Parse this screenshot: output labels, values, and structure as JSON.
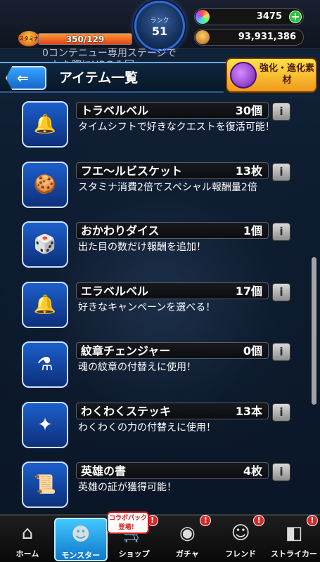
{
  "status": {
    "stamina_label": "スタミナ",
    "stamina_text": "350/129",
    "stamina_fraction": 1.0,
    "rank_label": "ランク",
    "rank_value": "51",
    "orbs": "3475",
    "orb_plus": "+",
    "gold": "93,931,386"
  },
  "header": {
    "background_text": "0コンテニュー専用ステージで\n…した際にHPのみ回",
    "back_icon": "back-arrow-icon",
    "title": "アイテム一覧",
    "evolve_label": "強化・進化素材"
  },
  "items": [
    {
      "name": "トラベルベル",
      "count": "30個",
      "desc": "タイムシフトで好きなクエストを復活可能！",
      "icon": "bell-icon",
      "glyph": "🔔"
    },
    {
      "name": "フエ〜ルビスケット",
      "count": "13枚",
      "desc": "スタミナ消費2倍でスペシャル報酬量2倍",
      "icon": "biscuit-icon",
      "glyph": "🍪"
    },
    {
      "name": "おかわりダイス",
      "count": "1個",
      "desc": "出た目の数だけ報酬を追加！",
      "icon": "dice-icon",
      "glyph": "🎲"
    },
    {
      "name": "エラベルベル",
      "count": "17個",
      "desc": "好きなキャンペーンを選べる！",
      "icon": "golden-bell-icon",
      "glyph": "🔔"
    },
    {
      "name": "紋章チェンジャー",
      "count": "0個",
      "desc": "魂の紋章の付替えに使用！",
      "icon": "emblem-changer-icon",
      "glyph": "⚗"
    },
    {
      "name": "わくわくステッキ",
      "count": "13本",
      "desc": "わくわくの力の付替えに使用！",
      "icon": "wand-icon",
      "glyph": "✦"
    },
    {
      "name": "英雄の書",
      "count": "4枚",
      "desc": "英雄の証が獲得可能！",
      "icon": "scroll-icon",
      "glyph": "📜"
    }
  ],
  "info_button_label": "i",
  "nav": {
    "collab_sticker": "コラボパック登場！",
    "tabs": [
      {
        "label": "ホーム",
        "icon": "home-icon",
        "glyph": "⌂"
      },
      {
        "label": "モンスター",
        "icon": "monster-icon",
        "glyph": "☻"
      },
      {
        "label": "ショップ",
        "icon": "shop-cart-icon",
        "glyph": "🛒"
      },
      {
        "label": "ガチャ",
        "icon": "gacha-icon",
        "glyph": "◉"
      },
      {
        "label": "フレンド",
        "icon": "friend-icon",
        "glyph": "☺"
      },
      {
        "label": "ストライカー",
        "icon": "striker-icon",
        "glyph": "◧"
      }
    ],
    "badge": "!"
  },
  "colors": {
    "accent_blue": "#1c5fcc",
    "evolve_yellow": "#ffe34a",
    "badge_red": "#d62a2a"
  }
}
